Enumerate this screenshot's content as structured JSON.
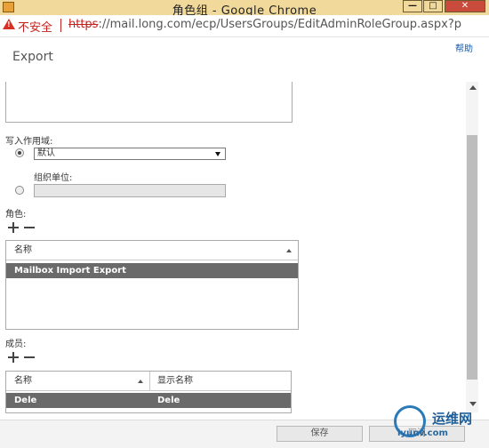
{
  "window": {
    "title": "角色组 - Google Chrome",
    "minimize": "—",
    "maximize": "□",
    "close": "✕"
  },
  "address_bar": {
    "security_label": "不安全",
    "url_protocol": "https",
    "url_rest": "://mail.long.com/ecp/UsersGroups/EditAdminRoleGroup.aspx?p"
  },
  "page": {
    "help": "帮助",
    "dialog_title": "Export"
  },
  "write_scope": {
    "label": "写入作用域:",
    "default_selected": true,
    "dropdown_value": "默认",
    "ou_label": "组织单位:",
    "ou_value": ""
  },
  "roles": {
    "label": "角色:",
    "column_header": "名称",
    "rows": [
      "Mailbox Import Export"
    ]
  },
  "members": {
    "label": "成员:",
    "columns": [
      "名称",
      "显示名称"
    ],
    "rows": [
      {
        "name": "Dele",
        "display_name": "Dele"
      }
    ]
  },
  "footer": {
    "save": "保存",
    "cancel": "取消"
  },
  "watermark": {
    "line1": "运维网",
    "line2": "iyunv.com"
  },
  "colors": {
    "title_bar": "#f0d99a",
    "selected_row": "#6a6a6a",
    "help_link": "#1a5aa6",
    "insecure": "#c5221f"
  },
  "icons": {
    "add": "plus-icon",
    "remove": "minus-icon",
    "warning": "warning-triangle-icon",
    "sort": "sort-ascending-icon",
    "dropdown": "chevron-down-icon"
  }
}
